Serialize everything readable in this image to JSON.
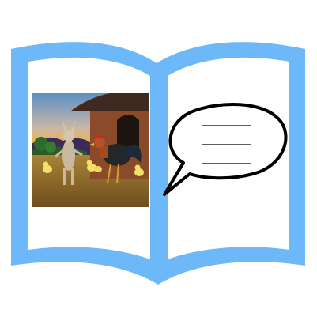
{
  "colors": {
    "book_blue": "#6DB8F8",
    "book_page": "#FFFFFF",
    "bubble_stroke": "#000000",
    "bubble_fill": "#FFFFFF",
    "sky_top": "#5C8FC5",
    "sky_mid": "#C9B7A6",
    "sunset": "#F0B14A",
    "ground": "#8E6A2E",
    "hut_wall": "#8B4A2A",
    "hut_roof": "#3E2A20"
  },
  "icons": {
    "book": "open-book-icon",
    "speech": "speech-bubble-icon"
  },
  "illustration": {
    "subject": "rabbit-and-rooster-scene"
  },
  "speech_bubble": {
    "line_count": 3
  }
}
